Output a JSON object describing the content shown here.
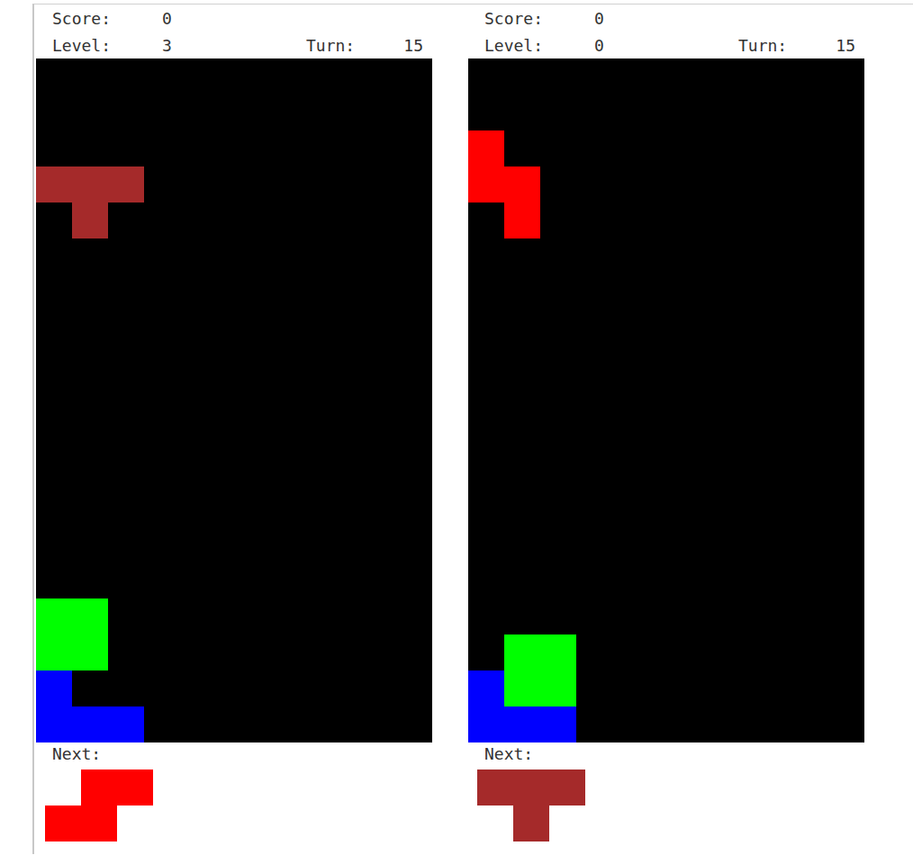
{
  "players": [
    {
      "score_label": "Score:",
      "score": "0",
      "level_label": "Level:",
      "level": "3",
      "turn_label": "Turn:",
      "turn": "15",
      "board": {
        "rows": 19,
        "cols": 11,
        "blocks": [
          {
            "row": 3,
            "col": 0,
            "color": "#a52a2a"
          },
          {
            "row": 3,
            "col": 1,
            "color": "#a52a2a"
          },
          {
            "row": 3,
            "col": 2,
            "color": "#a52a2a"
          },
          {
            "row": 4,
            "col": 1,
            "color": "#a52a2a"
          },
          {
            "row": 15,
            "col": 0,
            "color": "#00ff00"
          },
          {
            "row": 15,
            "col": 1,
            "color": "#00ff00"
          },
          {
            "row": 16,
            "col": 0,
            "color": "#00ff00"
          },
          {
            "row": 16,
            "col": 1,
            "color": "#00ff00"
          },
          {
            "row": 17,
            "col": 0,
            "color": "#0000ff"
          },
          {
            "row": 18,
            "col": 0,
            "color": "#0000ff"
          },
          {
            "row": 18,
            "col": 1,
            "color": "#0000ff"
          },
          {
            "row": 18,
            "col": 2,
            "color": "#0000ff"
          }
        ]
      },
      "next_label": "Next:",
      "next": {
        "rows": 2,
        "cols": 3,
        "blocks": [
          {
            "row": 0,
            "col": 1,
            "color": "#ff0000"
          },
          {
            "row": 0,
            "col": 2,
            "color": "#ff0000"
          },
          {
            "row": 1,
            "col": 0,
            "color": "#ff0000"
          },
          {
            "row": 1,
            "col": 1,
            "color": "#ff0000"
          }
        ]
      }
    },
    {
      "score_label": "Score:",
      "score": "0",
      "level_label": "Level:",
      "level": "0",
      "turn_label": "Turn:",
      "turn": "15",
      "board": {
        "rows": 19,
        "cols": 11,
        "blocks": [
          {
            "row": 2,
            "col": 0,
            "color": "#ff0000"
          },
          {
            "row": 3,
            "col": 0,
            "color": "#ff0000"
          },
          {
            "row": 3,
            "col": 1,
            "color": "#ff0000"
          },
          {
            "row": 4,
            "col": 1,
            "color": "#ff0000"
          },
          {
            "row": 16,
            "col": 1,
            "color": "#00ff00"
          },
          {
            "row": 16,
            "col": 2,
            "color": "#00ff00"
          },
          {
            "row": 17,
            "col": 1,
            "color": "#00ff00"
          },
          {
            "row": 17,
            "col": 2,
            "color": "#00ff00"
          },
          {
            "row": 17,
            "col": 0,
            "color": "#0000ff"
          },
          {
            "row": 18,
            "col": 0,
            "color": "#0000ff"
          },
          {
            "row": 18,
            "col": 1,
            "color": "#0000ff"
          },
          {
            "row": 18,
            "col": 2,
            "color": "#0000ff"
          }
        ]
      },
      "next_label": "Next:",
      "next": {
        "rows": 2,
        "cols": 3,
        "blocks": [
          {
            "row": 0,
            "col": 0,
            "color": "#a52a2a"
          },
          {
            "row": 0,
            "col": 1,
            "color": "#a52a2a"
          },
          {
            "row": 0,
            "col": 2,
            "color": "#a52a2a"
          },
          {
            "row": 1,
            "col": 1,
            "color": "#a52a2a"
          }
        ]
      }
    }
  ]
}
